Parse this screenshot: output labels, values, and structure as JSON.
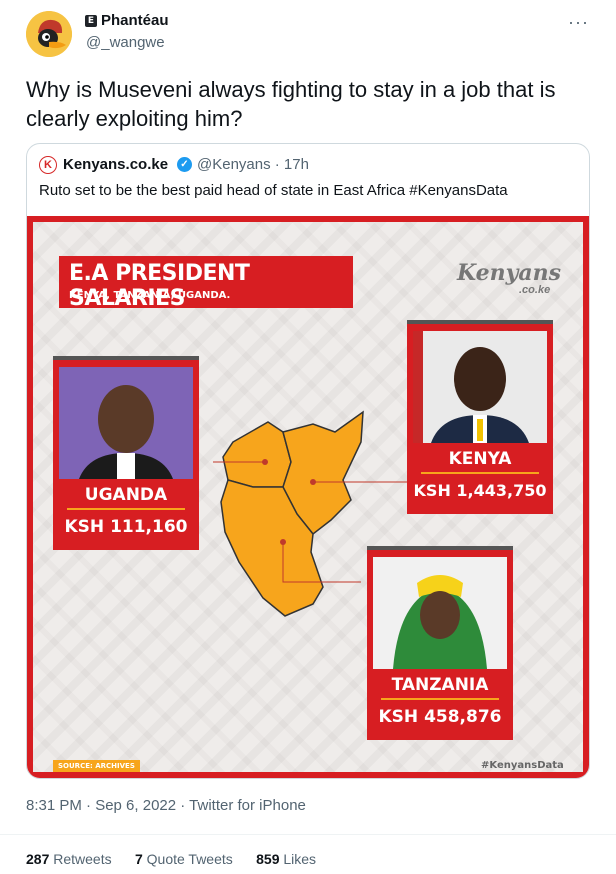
{
  "author": {
    "name": "Phantéau",
    "handle": "@_wangwe",
    "badge": "E"
  },
  "more_icon": "more-horizontal-icon",
  "tweet_text": "Why is Museveni always fighting to stay in a job that is clearly exploiting him?",
  "quote": {
    "logo_letter": "K",
    "name": "Kenyans.co.ke",
    "handle": "@Kenyans · 17h",
    "text": "Ruto set to be the best paid head of state in East Africa #KenyansData"
  },
  "infographic": {
    "title": "E.A PRESIDENT SALARIES",
    "subtitle": "KENYA, TANZANIA, UGANDA.",
    "brand": "Kenyans",
    "brand_suffix": ".co.ke",
    "countries": [
      {
        "name": "UGANDA",
        "salary": "KSH 111,160"
      },
      {
        "name": "KENYA",
        "salary": "KSH 1,443,750"
      },
      {
        "name": "TANZANIA",
        "salary": "KSH 458,876"
      }
    ],
    "source": "SOURCE: ARCHIVES",
    "hashtag": "#KenyansData",
    "colors": {
      "red": "#d71e22",
      "orange": "#f7a51c",
      "map": "#f7a51c"
    }
  },
  "meta": "8:31 PM · Sep 6, 2022 · Twitter for iPhone",
  "stats": {
    "retweets_count": "287",
    "retweets_label": "Retweets",
    "quotes_count": "7",
    "quotes_label": "Quote Tweets",
    "likes_count": "859",
    "likes_label": "Likes"
  }
}
